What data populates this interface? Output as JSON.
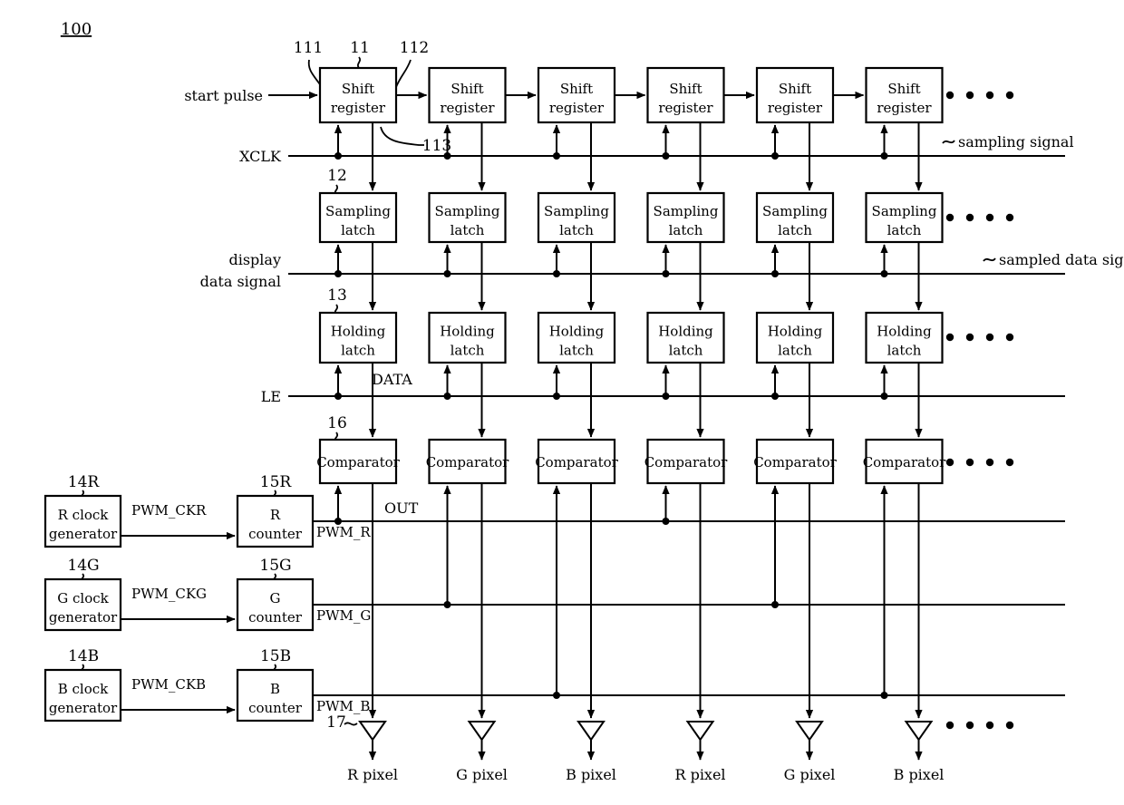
{
  "figure": {
    "number": "100",
    "type": "display-driver-block-diagram"
  },
  "signals": {
    "start_pulse": "start pulse",
    "xclk": "XCLK",
    "display_data_line1": "display",
    "display_data_line2": "data signal",
    "le": "LE",
    "data": "DATA",
    "out": "OUT",
    "sampling_signal": "sampling signal",
    "sampled_data_signal": "sampled data signal"
  },
  "refs": {
    "r111": "111",
    "r11": "11",
    "r112": "112",
    "r113": "113",
    "r12": "12",
    "r13": "13",
    "r16": "16",
    "r17": "17",
    "r14R": "14R",
    "r14G": "14G",
    "r14B": "14B",
    "r15R": "15R",
    "r15G": "15G",
    "r15B": "15B"
  },
  "rows": {
    "shift_register": {
      "line1": "Shift",
      "line2": "register"
    },
    "sampling_latch": {
      "line1": "Sampling",
      "line2": "latch"
    },
    "holding_latch": {
      "line1": "Holding",
      "line2": "latch"
    },
    "comparator": {
      "line1": "Comparator"
    }
  },
  "columns": [
    {
      "index": 0,
      "pwm": "PWM_R",
      "pixel": "R pixel"
    },
    {
      "index": 1,
      "pwm": "PWM_G",
      "pixel": "G pixel"
    },
    {
      "index": 2,
      "pwm": "PWM_B",
      "pixel": "B pixel"
    },
    {
      "index": 3,
      "pwm": "PWM_R",
      "pixel": "R pixel"
    },
    {
      "index": 4,
      "pwm": "PWM_G",
      "pixel": "G pixel"
    },
    {
      "index": 5,
      "pwm": "PWM_B",
      "pixel": "B pixel"
    }
  ],
  "generators": [
    {
      "line1": "R clock",
      "line2": "generator",
      "out": "PWM_CKR",
      "ref": "14R"
    },
    {
      "line1": "G clock",
      "line2": "generator",
      "out": "PWM_CKG",
      "ref": "14G"
    },
    {
      "line1": "B clock",
      "line2": "generator",
      "out": "PWM_CKB",
      "ref": "14B"
    }
  ],
  "counters": [
    {
      "line1": "R",
      "line2": "counter",
      "out": "PWM_R",
      "ref": "15R"
    },
    {
      "line1": "G",
      "line2": "counter",
      "out": "PWM_G",
      "ref": "15G"
    },
    {
      "line1": "B",
      "line2": "counter",
      "out": "PWM_B",
      "ref": "15B"
    }
  ],
  "ellipsis": "• • • •",
  "colors": {
    "stroke": "#000000",
    "background": "#ffffff"
  }
}
